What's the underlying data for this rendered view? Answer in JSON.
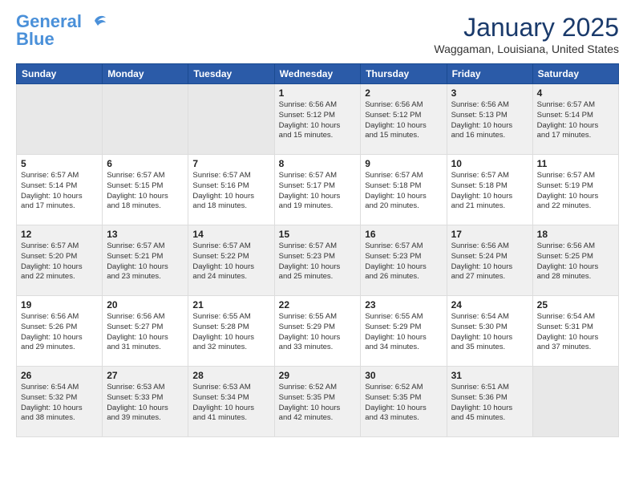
{
  "header": {
    "logo_line1": "General",
    "logo_line2": "Blue",
    "month_title": "January 2025",
    "location": "Waggaman, Louisiana, United States"
  },
  "weekdays": [
    "Sunday",
    "Monday",
    "Tuesday",
    "Wednesday",
    "Thursday",
    "Friday",
    "Saturday"
  ],
  "weeks": [
    [
      {
        "day": "",
        "empty": true
      },
      {
        "day": "",
        "empty": true
      },
      {
        "day": "",
        "empty": true
      },
      {
        "day": "1",
        "sunrise": "6:56 AM",
        "sunset": "5:12 PM",
        "daylight": "10 hours and 15 minutes."
      },
      {
        "day": "2",
        "sunrise": "6:56 AM",
        "sunset": "5:12 PM",
        "daylight": "10 hours and 15 minutes."
      },
      {
        "day": "3",
        "sunrise": "6:56 AM",
        "sunset": "5:13 PM",
        "daylight": "10 hours and 16 minutes."
      },
      {
        "day": "4",
        "sunrise": "6:57 AM",
        "sunset": "5:14 PM",
        "daylight": "10 hours and 17 minutes."
      }
    ],
    [
      {
        "day": "5",
        "sunrise": "6:57 AM",
        "sunset": "5:14 PM",
        "daylight": "10 hours and 17 minutes."
      },
      {
        "day": "6",
        "sunrise": "6:57 AM",
        "sunset": "5:15 PM",
        "daylight": "10 hours and 18 minutes."
      },
      {
        "day": "7",
        "sunrise": "6:57 AM",
        "sunset": "5:16 PM",
        "daylight": "10 hours and 18 minutes."
      },
      {
        "day": "8",
        "sunrise": "6:57 AM",
        "sunset": "5:17 PM",
        "daylight": "10 hours and 19 minutes."
      },
      {
        "day": "9",
        "sunrise": "6:57 AM",
        "sunset": "5:18 PM",
        "daylight": "10 hours and 20 minutes."
      },
      {
        "day": "10",
        "sunrise": "6:57 AM",
        "sunset": "5:18 PM",
        "daylight": "10 hours and 21 minutes."
      },
      {
        "day": "11",
        "sunrise": "6:57 AM",
        "sunset": "5:19 PM",
        "daylight": "10 hours and 22 minutes."
      }
    ],
    [
      {
        "day": "12",
        "sunrise": "6:57 AM",
        "sunset": "5:20 PM",
        "daylight": "10 hours and 22 minutes."
      },
      {
        "day": "13",
        "sunrise": "6:57 AM",
        "sunset": "5:21 PM",
        "daylight": "10 hours and 23 minutes."
      },
      {
        "day": "14",
        "sunrise": "6:57 AM",
        "sunset": "5:22 PM",
        "daylight": "10 hours and 24 minutes."
      },
      {
        "day": "15",
        "sunrise": "6:57 AM",
        "sunset": "5:23 PM",
        "daylight": "10 hours and 25 minutes."
      },
      {
        "day": "16",
        "sunrise": "6:57 AM",
        "sunset": "5:23 PM",
        "daylight": "10 hours and 26 minutes."
      },
      {
        "day": "17",
        "sunrise": "6:56 AM",
        "sunset": "5:24 PM",
        "daylight": "10 hours and 27 minutes."
      },
      {
        "day": "18",
        "sunrise": "6:56 AM",
        "sunset": "5:25 PM",
        "daylight": "10 hours and 28 minutes."
      }
    ],
    [
      {
        "day": "19",
        "sunrise": "6:56 AM",
        "sunset": "5:26 PM",
        "daylight": "10 hours and 29 minutes."
      },
      {
        "day": "20",
        "sunrise": "6:56 AM",
        "sunset": "5:27 PM",
        "daylight": "10 hours and 31 minutes."
      },
      {
        "day": "21",
        "sunrise": "6:55 AM",
        "sunset": "5:28 PM",
        "daylight": "10 hours and 32 minutes."
      },
      {
        "day": "22",
        "sunrise": "6:55 AM",
        "sunset": "5:29 PM",
        "daylight": "10 hours and 33 minutes."
      },
      {
        "day": "23",
        "sunrise": "6:55 AM",
        "sunset": "5:29 PM",
        "daylight": "10 hours and 34 minutes."
      },
      {
        "day": "24",
        "sunrise": "6:54 AM",
        "sunset": "5:30 PM",
        "daylight": "10 hours and 35 minutes."
      },
      {
        "day": "25",
        "sunrise": "6:54 AM",
        "sunset": "5:31 PM",
        "daylight": "10 hours and 37 minutes."
      }
    ],
    [
      {
        "day": "26",
        "sunrise": "6:54 AM",
        "sunset": "5:32 PM",
        "daylight": "10 hours and 38 minutes."
      },
      {
        "day": "27",
        "sunrise": "6:53 AM",
        "sunset": "5:33 PM",
        "daylight": "10 hours and 39 minutes."
      },
      {
        "day": "28",
        "sunrise": "6:53 AM",
        "sunset": "5:34 PM",
        "daylight": "10 hours and 41 minutes."
      },
      {
        "day": "29",
        "sunrise": "6:52 AM",
        "sunset": "5:35 PM",
        "daylight": "10 hours and 42 minutes."
      },
      {
        "day": "30",
        "sunrise": "6:52 AM",
        "sunset": "5:35 PM",
        "daylight": "10 hours and 43 minutes."
      },
      {
        "day": "31",
        "sunrise": "6:51 AM",
        "sunset": "5:36 PM",
        "daylight": "10 hours and 45 minutes."
      },
      {
        "day": "",
        "empty": true
      }
    ]
  ],
  "labels": {
    "sunrise_prefix": "Sunrise: ",
    "sunset_prefix": "Sunset: ",
    "daylight_prefix": "Daylight: "
  }
}
